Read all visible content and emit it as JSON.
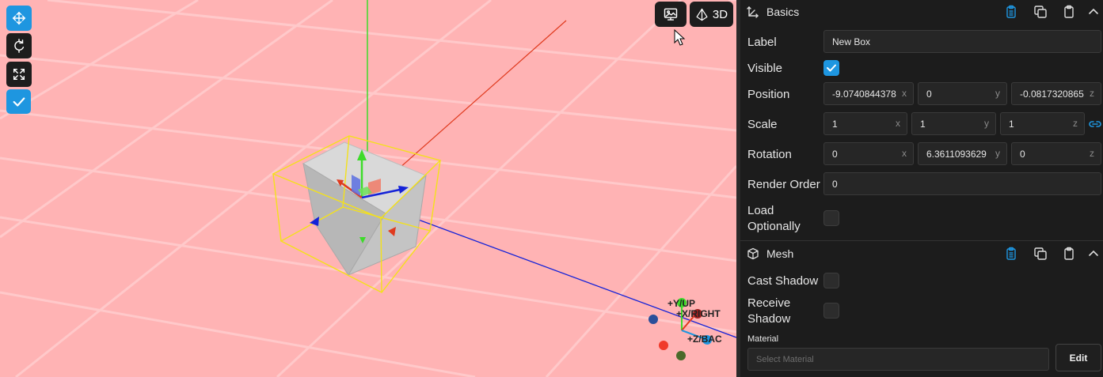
{
  "viewport": {
    "view_mode_label": "3D",
    "gizmo": {
      "y_label": "+Y/UP",
      "x_label": "+X/RIGHT",
      "z_label": "+Z/BAC"
    },
    "colors": {
      "background": "#ffb3b4",
      "selection_box": "#f4e11a",
      "x_axis": "#e03a1e",
      "y_axis": "#3ddb2a",
      "z_axis": "#1422d8"
    }
  },
  "toolbar": {
    "tools": [
      {
        "icon": "move-icon",
        "active": true
      },
      {
        "icon": "rotate-icon",
        "active": false
      },
      {
        "icon": "scale-icon",
        "active": false
      },
      {
        "icon": "check-icon",
        "active": true
      }
    ]
  },
  "panel": {
    "basics": {
      "title": "Basics",
      "label_label": "Label",
      "label_value": "New Box",
      "visible_label": "Visible",
      "visible_checked": true,
      "position_label": "Position",
      "position": {
        "x": "-9.0740844378",
        "y": "0",
        "z": "-0.0817320865"
      },
      "scale_label": "Scale",
      "scale": {
        "x": "1",
        "y": "1",
        "z": "1"
      },
      "rotation_label": "Rotation",
      "rotation": {
        "x": "0",
        "y": "6.3611093629",
        "z": "0"
      },
      "render_order_label": "Render Order",
      "render_order_value": "0",
      "load_optionally_label_1": "Load",
      "load_optionally_label_2": "Optionally",
      "load_optionally_checked": false,
      "axis_x": "x",
      "axis_y": "y",
      "axis_z": "z"
    },
    "mesh": {
      "title": "Mesh",
      "cast_shadow_label": "Cast Shadow",
      "cast_shadow_checked": false,
      "receive_shadow_label_1": "Receive",
      "receive_shadow_label_2": "Shadow",
      "receive_shadow_checked": false,
      "material_label": "Material",
      "material_placeholder": "Select Material",
      "edit_label": "Edit"
    },
    "accent_color": "#1e96e0"
  }
}
